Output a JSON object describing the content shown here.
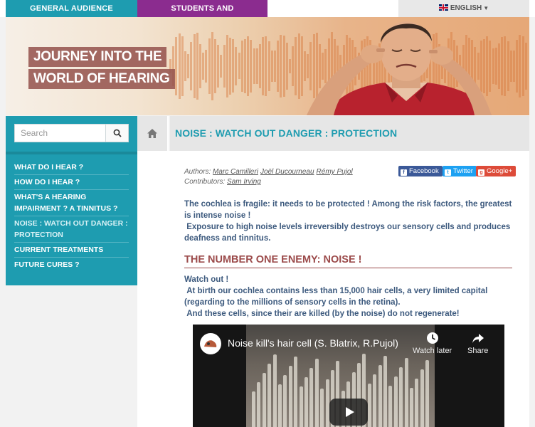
{
  "top_nav": {
    "general": "GENERAL AUDIENCE",
    "students": "STUDENTS AND PROFESSIONALS",
    "language": "ENGLISH"
  },
  "banner": {
    "line1": "JOURNEY INTO THE",
    "line2": "WORLD OF HEARING"
  },
  "search": {
    "placeholder": "Search"
  },
  "sidebar": {
    "items": [
      {
        "label": "WHAT DO I HEAR ?"
      },
      {
        "label": "HOW DO I HEAR ?"
      },
      {
        "label": "WHAT'S A HEARING IMPAIRMENT ? A TINNITUS ?"
      },
      {
        "label": "NOISE : WATCH OUT DANGER : PROTECTION"
      },
      {
        "label": "CURRENT TREATMENTS"
      },
      {
        "label": "FUTURE CURES ?"
      }
    ]
  },
  "page": {
    "title": "NOISE : WATCH OUT DANGER : PROTECTION",
    "authors_label": "Authors:",
    "authors": [
      "Marc Camilleri",
      "Joël Ducourneau",
      "Rémy Pujol"
    ],
    "contributors_label": "Contributors:",
    "contributors": [
      "Sam Irving"
    ],
    "share": {
      "facebook": "Facebook",
      "twitter": "Twitter",
      "google": "Google+"
    },
    "intro_1": "The cochlea is fragile: it needs to be protected ! Among the risk factors, the greatest is intense noise !",
    "intro_2": "Exposure to high noise levels irreversibly destroys our sensory cells and produces deafness and tinnitus.",
    "section_heading": "THE NUMBER ONE ENEMY: NOISE !",
    "body_1": "Watch out !",
    "body_2": "At birth our cochlea contains less than 15,000 hair cells, a very limited capital (regarding to the millions of sensory cells in the retina).",
    "body_3": "And these cells, since their are killed (by the noise) do not regenerate!"
  },
  "video": {
    "title": "Noise kill's hair cell (S. Blatrix, R.Pujol)",
    "watch_later": "Watch later",
    "share": "Share"
  }
}
